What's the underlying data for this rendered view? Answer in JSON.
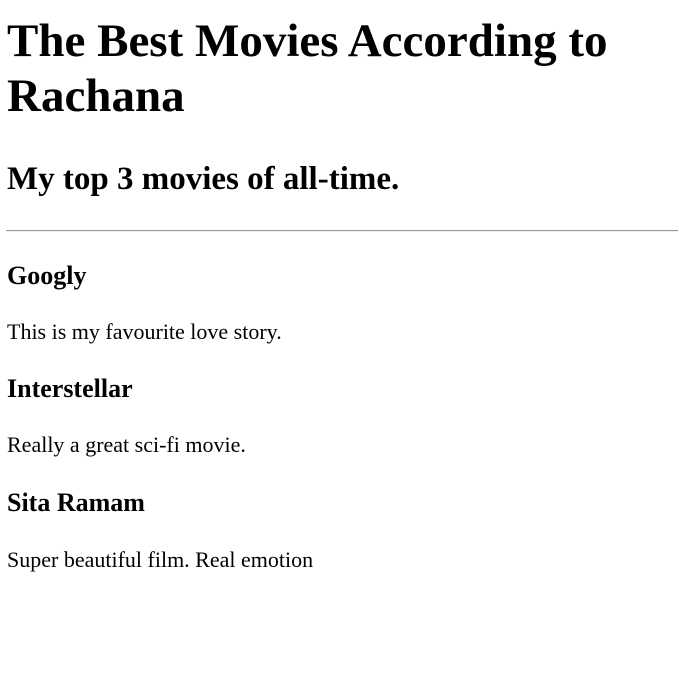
{
  "page": {
    "title": "The Best Movies According to Rachana",
    "subtitle": "My top 3 movies of all-time."
  },
  "movies": [
    {
      "title": "Googly",
      "description": "This is my favourite love story."
    },
    {
      "title": "Interstellar",
      "description": "Really a great sci-fi movie."
    },
    {
      "title": "Sita Ramam",
      "description": "Super beautiful film. Real emotion"
    }
  ]
}
